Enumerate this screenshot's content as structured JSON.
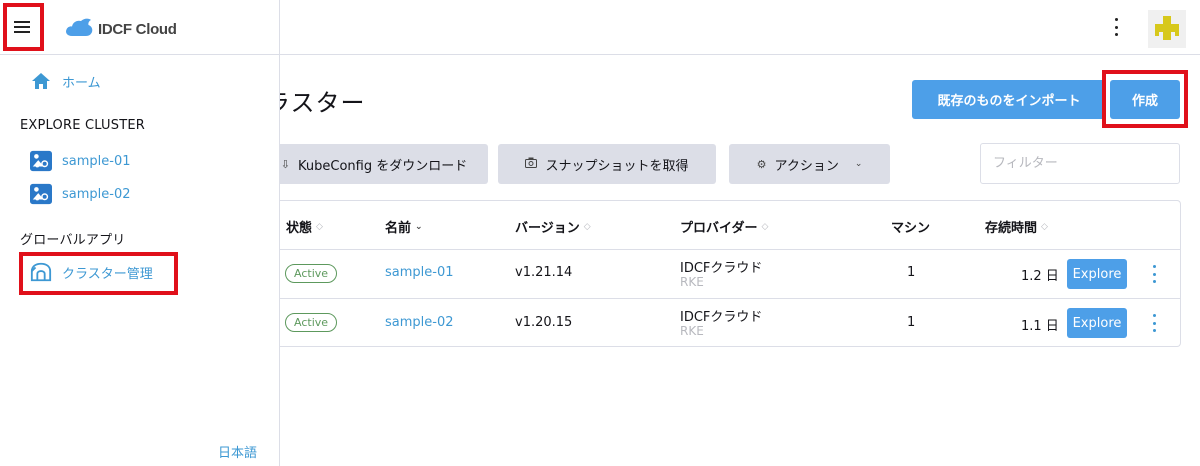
{
  "app": {
    "logo_text": "IDCF Cloud"
  },
  "sidebar": {
    "home_label": "ホーム",
    "explore_heading": "EXPLORE CLUSTER",
    "clusters": [
      {
        "label": "sample-01"
      },
      {
        "label": "sample-02"
      }
    ],
    "global_heading": "グローバルアプリ",
    "cluster_management_label": "クラスター管理",
    "language_label": "日本語"
  },
  "main": {
    "title": "ラスター",
    "import_button": "既存のものをインポート",
    "create_button": "作成",
    "kubeconfig_button": "KubeConfig をダウンロード",
    "snapshot_button": "スナップショットを取得",
    "action_button": "アクション",
    "filter_placeholder": "フィルター"
  },
  "table": {
    "headers": {
      "state": "状態",
      "name": "名前",
      "version": "バージョン",
      "provider": "プロバイダー",
      "machines": "マシン",
      "age": "存続時間"
    },
    "rows": [
      {
        "state": "Active",
        "name": "sample-01",
        "version": "v1.21.14",
        "provider": "IDCFクラウド",
        "provider_sub": "RKE",
        "machines": "1",
        "age": "1.2 日",
        "explore": "Explore"
      },
      {
        "state": "Active",
        "name": "sample-02",
        "version": "v1.20.15",
        "provider": "IDCFクラウド",
        "provider_sub": "RKE",
        "machines": "1",
        "age": "1.1 日",
        "explore": "Explore"
      }
    ]
  },
  "colors": {
    "accent": "#4d9fe8",
    "link": "#3d98d3",
    "highlight": "#e0101a",
    "active_badge": "#5d995d"
  },
  "icons": {
    "hamburger": "hamburger-menu-icon",
    "logo": "cloud-icon",
    "home": "home-icon",
    "cluster": "cluster-icon",
    "cluster_management": "cluster-management-icon",
    "kubeconfig": "download-icon",
    "snapshot": "camera-icon",
    "action": "gear-icon",
    "sort": "sort-icon",
    "more": "kebab-icon"
  }
}
